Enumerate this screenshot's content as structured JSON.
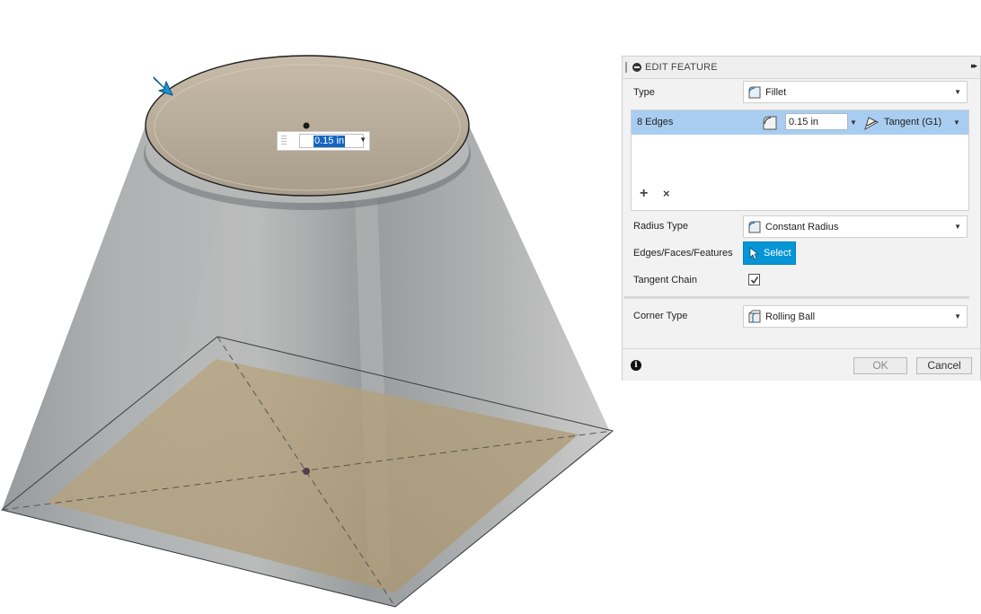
{
  "viewport": {
    "radius_manipulator": {
      "value": "0.15 in"
    }
  },
  "dialog": {
    "title": "EDIT FEATURE",
    "expand_glyph": "▸▸",
    "type": {
      "label": "Type",
      "value": "Fillet",
      "icon": "fillet-icon"
    },
    "edge_set": {
      "label": "8 Edges",
      "radius": "0.15 in",
      "continuity": "Tangent (G1)",
      "add_glyph": "+",
      "remove_glyph": "×"
    },
    "radius_type": {
      "label": "Radius Type",
      "value": "Constant Radius",
      "icon": "constant-radius-icon"
    },
    "edges_faces_features": {
      "label": "Edges/Faces/Features",
      "button": "Select",
      "icon": "cursor-arrow-icon"
    },
    "tangent_chain": {
      "label": "Tangent Chain",
      "checked": true
    },
    "corner_type": {
      "label": "Corner Type",
      "value": "Rolling Ball",
      "icon": "rolling-ball-icon"
    },
    "footer": {
      "info_glyph": "i",
      "ok": "OK",
      "cancel": "Cancel"
    }
  },
  "colors": {
    "selection_blue": "#a9cdf0",
    "select_button": "#0696d7",
    "body_shell": "#9a9fa1",
    "top_face": "#b9ad9c",
    "base_face": "#c4b08b"
  }
}
